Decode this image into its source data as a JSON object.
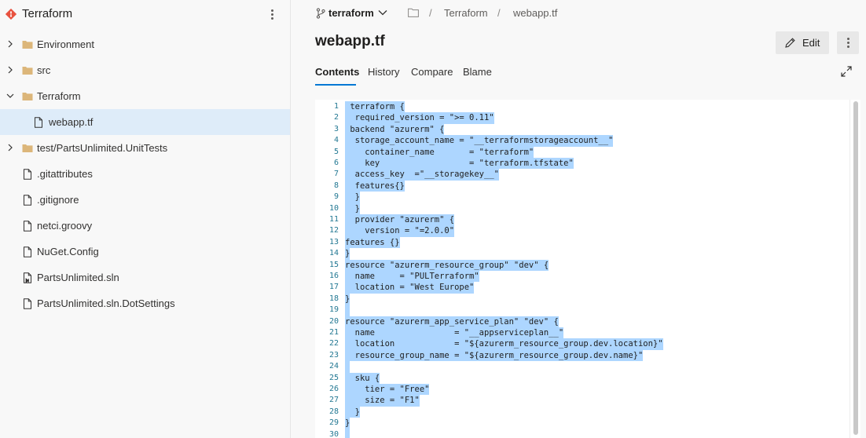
{
  "repo": {
    "name": "Terraform"
  },
  "tree": [
    {
      "name": "Environment",
      "type": "folder",
      "expandable": true,
      "expanded": false,
      "depth": 0
    },
    {
      "name": "src",
      "type": "folder",
      "expandable": true,
      "expanded": false,
      "depth": 0
    },
    {
      "name": "Terraform",
      "type": "folder",
      "expandable": true,
      "expanded": true,
      "depth": 0
    },
    {
      "name": "webapp.tf",
      "type": "file",
      "expandable": false,
      "depth": 1,
      "selected": true
    },
    {
      "name": "test/PartsUnlimited.UnitTests",
      "type": "folder",
      "expandable": true,
      "expanded": false,
      "depth": 0
    },
    {
      "name": ".gitattributes",
      "type": "file",
      "expandable": false,
      "depth": 0
    },
    {
      "name": ".gitignore",
      "type": "file",
      "expandable": false,
      "depth": 0
    },
    {
      "name": "netci.groovy",
      "type": "file",
      "expandable": false,
      "depth": 0
    },
    {
      "name": "NuGet.Config",
      "type": "file",
      "expandable": false,
      "depth": 0
    },
    {
      "name": "PartsUnlimited.sln",
      "type": "solution",
      "expandable": false,
      "depth": 0
    },
    {
      "name": "PartsUnlimited.sln.DotSettings",
      "type": "file",
      "expandable": false,
      "depth": 0
    }
  ],
  "header": {
    "branch": "terraform",
    "breadcrumb": [
      "Terraform",
      "webapp.tf"
    ],
    "separator": "/",
    "file_title": "webapp.tf",
    "edit_label": "Edit"
  },
  "tabs": [
    "Contents",
    "History",
    "Compare",
    "Blame"
  ],
  "colors": {
    "accent": "#0078d4",
    "selection": "#add6ff",
    "line_number": "#237893",
    "folder": "#dcb67a",
    "repo_logo": "#e8523f"
  },
  "code_lines": [
    " terraform {",
    "  required_version = \">= 0.11\"",
    " backend \"azurerm\" {",
    "  storage_account_name = \"__terraformstorageaccount__\"",
    "    container_name       = \"terraform\"",
    "    key                  = \"terraform.tfstate\"",
    "  access_key  =\"__storagekey__\"",
    "  features{}",
    "  }",
    "  }",
    "  provider \"azurerm\" {",
    "    version = \"=2.0.0\"",
    "features {}",
    "}",
    "resource \"azurerm_resource_group\" \"dev\" {",
    "  name     = \"PULTerraform\"",
    "  location = \"West Europe\"",
    "}",
    " ",
    "resource \"azurerm_app_service_plan\" \"dev\" {",
    "  name                = \"__appserviceplan__\"",
    "  location            = \"${azurerm_resource_group.dev.location}\"",
    "  resource_group_name = \"${azurerm_resource_group.dev.name}\"",
    " ",
    "  sku {",
    "    tier = \"Free\"",
    "    size = \"F1\"",
    "  }",
    "}",
    " "
  ]
}
